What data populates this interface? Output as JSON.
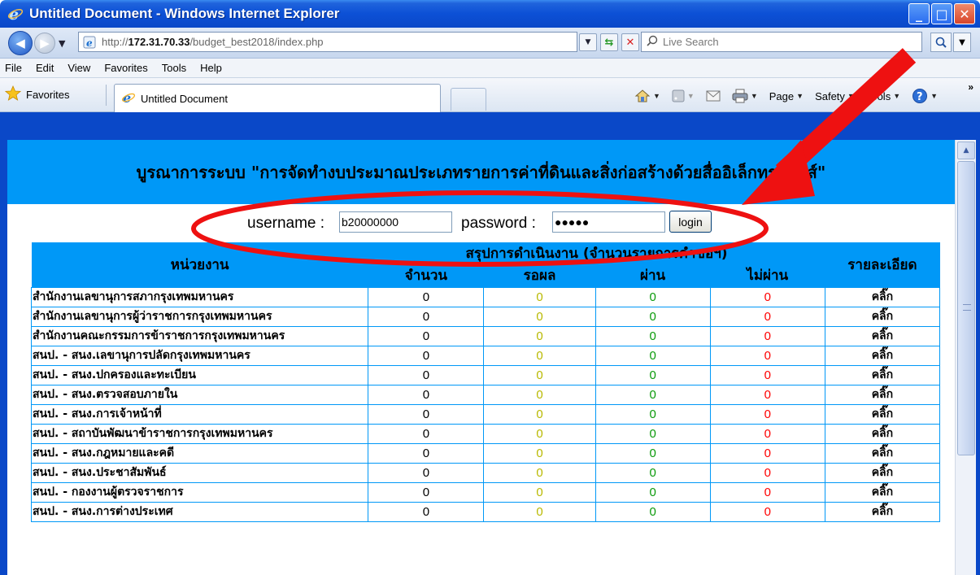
{
  "window": {
    "title": "Untitled Document - Windows Internet Explorer"
  },
  "address_bar": {
    "url_prefix": "http://",
    "url_host": "172.31.70.33",
    "url_path": "/budget_best2018/index.php",
    "search_placeholder": "Live Search"
  },
  "menu": [
    "File",
    "Edit",
    "View",
    "Favorites",
    "Tools",
    "Help"
  ],
  "favorites_bar": {
    "favorites_label": "Favorites",
    "tab_title": "Untitled Document",
    "commands": [
      "Page",
      "Safety",
      "Tools"
    ]
  },
  "page": {
    "header_title": "บูรณาการระบบ \"การจัดทำงบประมาณประเภทรายการค่าที่ดินและสิ่งก่อสร้างด้วยสื่ออิเล็กทรอนิกส์\"",
    "login": {
      "username_label": "username :",
      "username_value": "b20000000",
      "password_label": "password :",
      "password_value": "●●●●●",
      "login_button": "login"
    },
    "table": {
      "col_unit": "หน่วยงาน",
      "col_summary": "สรุปการดำเนินงาน (จำนวนรายการคำขอฯ)",
      "col_total": "จำนวน",
      "col_pending": "รอผล",
      "col_pass": "ผ่าน",
      "col_fail": "ไม่ผ่าน",
      "col_detail": "รายละเอียด",
      "rows": [
        {
          "unit": "สำนักงานเลขานุการสภากรุงเทพมหานคร",
          "total": "0",
          "pending": "0",
          "pass": "0",
          "fail": "0",
          "detail": "คลิ๊ก"
        },
        {
          "unit": "สำนักงานเลขานุการผู้ว่าราชการกรุงเทพมหานคร",
          "total": "0",
          "pending": "0",
          "pass": "0",
          "fail": "0",
          "detail": "คลิ๊ก"
        },
        {
          "unit": "สำนักงานคณะกรรมการข้าราชการกรุงเทพมหานคร",
          "total": "0",
          "pending": "0",
          "pass": "0",
          "fail": "0",
          "detail": "คลิ๊ก"
        },
        {
          "unit": "สนป. - สนง.เลขานุการปลัดกรุงเทพมหานคร",
          "total": "0",
          "pending": "0",
          "pass": "0",
          "fail": "0",
          "detail": "คลิ๊ก"
        },
        {
          "unit": "สนป. - สนง.ปกครองและทะเบียน",
          "total": "0",
          "pending": "0",
          "pass": "0",
          "fail": "0",
          "detail": "คลิ๊ก"
        },
        {
          "unit": "สนป. - สนง.ตรวจสอบภายใน",
          "total": "0",
          "pending": "0",
          "pass": "0",
          "fail": "0",
          "detail": "คลิ๊ก"
        },
        {
          "unit": "สนป. - สนง.การเจ้าหน้าที่",
          "total": "0",
          "pending": "0",
          "pass": "0",
          "fail": "0",
          "detail": "คลิ๊ก"
        },
        {
          "unit": "สนป. - สถาบันพัฒนาข้าราชการกรุงเทพมหานคร",
          "total": "0",
          "pending": "0",
          "pass": "0",
          "fail": "0",
          "detail": "คลิ๊ก"
        },
        {
          "unit": "สนป. - สนง.กฎหมายและคดี",
          "total": "0",
          "pending": "0",
          "pass": "0",
          "fail": "0",
          "detail": "คลิ๊ก"
        },
        {
          "unit": "สนป. - สนง.ประชาสัมพันธ์",
          "total": "0",
          "pending": "0",
          "pass": "0",
          "fail": "0",
          "detail": "คลิ๊ก"
        },
        {
          "unit": "สนป. - กองงานผู้ตรวจราชการ",
          "total": "0",
          "pending": "0",
          "pass": "0",
          "fail": "0",
          "detail": "คลิ๊ก"
        },
        {
          "unit": "สนป. - สนง.การต่างประเทศ",
          "total": "0",
          "pending": "0",
          "pass": "0",
          "fail": "0",
          "detail": "คลิ๊ก"
        }
      ]
    }
  },
  "colors": {
    "header_blue": "#0098f7",
    "pending": "#b9b900",
    "pass": "#0a9a0a",
    "fail": "#ff0000",
    "annotation_red": "#ee1111"
  }
}
